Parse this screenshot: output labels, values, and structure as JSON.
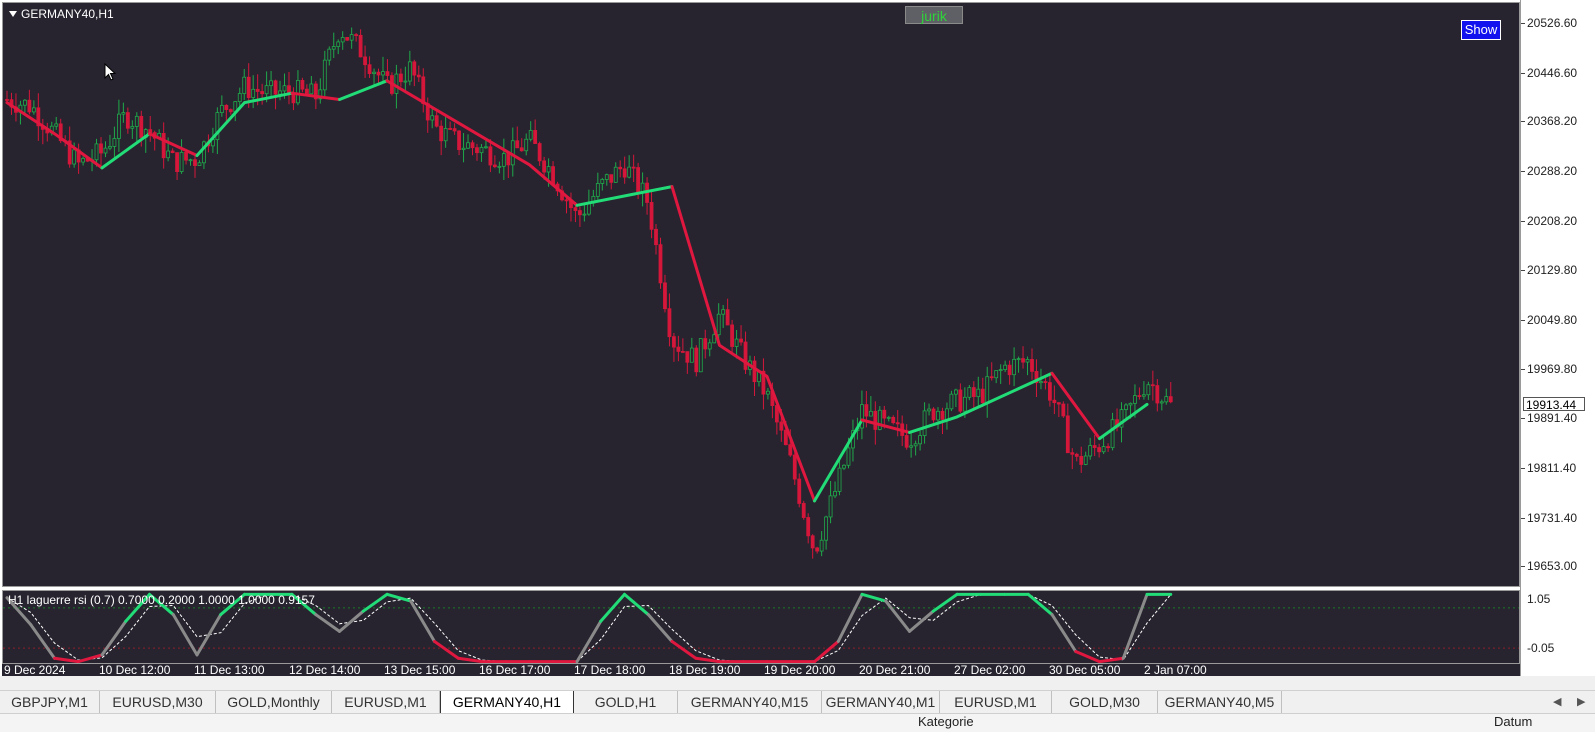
{
  "window": {
    "symbol_title": "GERMANY40,H1"
  },
  "buttons": {
    "jurik_label": "jurik",
    "show_label": "Show"
  },
  "price_axis": {
    "labels": [
      "20526.60",
      "20446.60",
      "20368.20",
      "20288.20",
      "20208.20",
      "20129.80",
      "20049.80",
      "19969.80",
      "19891.40",
      "19811.40",
      "19731.40",
      "19653.00"
    ],
    "current_price": "19913.44"
  },
  "indicator": {
    "title": "H1 laguerre rsi  (0.7) 0.7000 0.2000 1.0000 1.0000 0.9157",
    "level_labels": [
      "1.05",
      "-0.05"
    ]
  },
  "time_axis": {
    "labels": [
      "9 Dec 2024",
      "10 Dec 12:00",
      "11 Dec 13:00",
      "12 Dec 14:00",
      "13 Dec 15:00",
      "16 Dec 17:00",
      "17 Dec 18:00",
      "18 Dec 19:00",
      "19 Dec 20:00",
      "20 Dec 21:00",
      "27 Dec 02:00",
      "30 Dec 05:00",
      "2 Jan 07:00"
    ]
  },
  "tabs": [
    "GBPJPY,M1",
    "EURUSD,M30",
    "GOLD,Monthly",
    "EURUSD,M1",
    "GERMANY40,H1",
    "GOLD,H1",
    "GERMANY40,M15",
    "GERMANY40,M1",
    "EURUSD,M1",
    "GOLD,M30",
    "GERMANY40,M5"
  ],
  "active_tab_index": 4,
  "bottom_panel": {
    "col1": "Kategorie",
    "col2": "Datum"
  },
  "colors": {
    "background": "#27242f",
    "up_color": "#22dd77",
    "down_color": "#e0173f",
    "jurik_text": "#2fd43a",
    "show_button": "#1212ee"
  },
  "chart_data": {
    "type": "candlestick",
    "y_range": [
      19620,
      20560
    ],
    "price_path": [
      [
        "9 Dec 2024",
        20405
      ],
      [
        "",
        20395
      ],
      [
        "",
        20350
      ],
      [
        "",
        20300
      ],
      [
        "10 Dec 12:00",
        20320
      ],
      [
        "",
        20380
      ],
      [
        "",
        20355
      ],
      [
        "",
        20305
      ],
      [
        "11 Dec 13:00",
        20310
      ],
      [
        "",
        20385
      ],
      [
        "",
        20425
      ],
      [
        "",
        20415
      ],
      [
        "12 Dec 14:00",
        20418
      ],
      [
        "",
        20410
      ],
      [
        "",
        20520
      ],
      [
        "",
        20480
      ],
      [
        "13 Dec 15:00",
        20425
      ],
      [
        "",
        20455
      ],
      [
        "",
        20360
      ],
      [
        "",
        20335
      ],
      [
        "16 Dec 17:00",
        20325
      ],
      [
        "",
        20310
      ],
      [
        "",
        20340
      ],
      [
        "",
        20285
      ],
      [
        "17 Dec 18:00",
        20215
      ],
      [
        "",
        20265
      ],
      [
        "",
        20300
      ],
      [
        "18 Dec 19:00",
        20240
      ],
      [
        "",
        20020
      ],
      [
        "",
        19985
      ],
      [
        "",
        20060
      ],
      [
        "",
        19990
      ],
      [
        "19 Dec 20:00",
        19930
      ],
      [
        "",
        19820
      ],
      [
        "",
        19680
      ],
      [
        "",
        19790
      ],
      [
        "20 Dec 21:00",
        19905
      ],
      [
        "",
        19880
      ],
      [
        "",
        19860
      ],
      [
        "",
        19905
      ],
      [
        "27 Dec 02:00",
        19920
      ],
      [
        "",
        19930
      ],
      [
        "",
        19975
      ],
      [
        "",
        19985
      ],
      [
        "30 Dec 05:00",
        19930
      ],
      [
        "",
        19820
      ],
      [
        "",
        19850
      ],
      [
        "",
        19890
      ],
      [
        "2 Jan 07:00",
        19955
      ],
      [
        "",
        19913.44
      ]
    ],
    "jurik_series": [
      {
        "color": "down",
        "points": [
          [
            "9 Dec 2024",
            20400
          ],
          [
            "",
            20350
          ],
          [
            "10 Dec 12:00",
            20295
          ]
        ]
      },
      {
        "color": "up",
        "points": [
          [
            "10 Dec 12:00",
            20295
          ],
          [
            "",
            20350
          ]
        ]
      },
      {
        "color": "down",
        "points": [
          [
            "",
            20350
          ],
          [
            "11 Dec 13:00",
            20315
          ]
        ]
      },
      {
        "color": "up",
        "points": [
          [
            "11 Dec 13:00",
            20315
          ],
          [
            "",
            20400
          ],
          [
            "12 Dec 14:00",
            20415
          ]
        ]
      },
      {
        "color": "down",
        "points": [
          [
            "12 Dec 14:00",
            20415
          ],
          [
            "",
            20405
          ]
        ]
      },
      {
        "color": "up",
        "points": [
          [
            "",
            20405
          ],
          [
            "13 Dec 15:00",
            20435
          ]
        ]
      },
      {
        "color": "down",
        "points": [
          [
            "13 Dec 15:00",
            20435
          ],
          [
            "16 Dec 17:00",
            20345
          ],
          [
            "",
            20300
          ],
          [
            "17 Dec 18:00",
            20235
          ]
        ]
      },
      {
        "color": "up",
        "points": [
          [
            "17 Dec 18:00",
            20235
          ],
          [
            "18 Dec 19:00",
            20265
          ]
        ]
      },
      {
        "color": "down",
        "points": [
          [
            "18 Dec 19:00",
            20265
          ],
          [
            "",
            20010
          ],
          [
            "19 Dec 20:00",
            19960
          ],
          [
            "",
            19760
          ]
        ]
      },
      {
        "color": "up",
        "points": [
          [
            "",
            19760
          ],
          [
            "20 Dec 21:00",
            19890
          ]
        ]
      },
      {
        "color": "down",
        "points": [
          [
            "20 Dec 21:00",
            19890
          ],
          [
            "",
            19870
          ]
        ]
      },
      {
        "color": "up",
        "points": [
          [
            "",
            19870
          ],
          [
            "27 Dec 02:00",
            19895
          ],
          [
            "30 Dec 05:00",
            19965
          ]
        ]
      },
      {
        "color": "down",
        "points": [
          [
            "30 Dec 05:00",
            19965
          ],
          [
            "",
            19860
          ]
        ]
      },
      {
        "color": "up",
        "points": [
          [
            "",
            19860
          ],
          [
            "2 Jan 07:00",
            19915
          ]
        ]
      }
    ],
    "laguerre_rsi": {
      "y_range": [
        -0.05,
        1.05
      ],
      "levels": [
        0.8,
        0.2
      ],
      "path": [
        [
          "9 Dec 2024",
          0.95
        ],
        [
          "",
          0.55
        ],
        [
          "",
          0.05
        ],
        [
          "",
          0.0
        ],
        [
          "10 Dec 12:00",
          0.1
        ],
        [
          "",
          0.6
        ],
        [
          "",
          1.0
        ],
        [
          "",
          0.7
        ],
        [
          "11 Dec 13:00",
          0.1
        ],
        [
          "",
          0.7
        ],
        [
          "",
          1.0
        ],
        [
          "",
          1.0
        ],
        [
          "12 Dec 14:00",
          1.0
        ],
        [
          "",
          0.7
        ],
        [
          "",
          0.45
        ],
        [
          "",
          0.75
        ],
        [
          "13 Dec 15:00",
          1.0
        ],
        [
          "",
          0.9
        ],
        [
          "",
          0.3
        ],
        [
          "",
          0.05
        ],
        [
          "16 Dec 17:00",
          0.0
        ],
        [
          "",
          0.0
        ],
        [
          "",
          0.0
        ],
        [
          "",
          0.0
        ],
        [
          "17 Dec 18:00",
          0.0
        ],
        [
          "",
          0.6
        ],
        [
          "",
          1.0
        ],
        [
          "18 Dec 19:00",
          0.7
        ],
        [
          "",
          0.3
        ],
        [
          "",
          0.05
        ],
        [
          "",
          0.0
        ],
        [
          "",
          0.0
        ],
        [
          "19 Dec 20:00",
          0.0
        ],
        [
          "",
          0.0
        ],
        [
          "",
          0.0
        ],
        [
          "",
          0.3
        ],
        [
          "20 Dec 21:00",
          1.0
        ],
        [
          "",
          0.9
        ],
        [
          "",
          0.45
        ],
        [
          "",
          0.75
        ],
        [
          "27 Dec 02:00",
          1.0
        ],
        [
          "",
          1.0
        ],
        [
          "",
          1.0
        ],
        [
          "",
          1.0
        ],
        [
          "30 Dec 05:00",
          0.7
        ],
        [
          "",
          0.15
        ],
        [
          "",
          0.0
        ],
        [
          "",
          0.05
        ],
        [
          "2 Jan 07:00",
          1.0
        ],
        [
          "",
          1.0
        ]
      ]
    }
  }
}
